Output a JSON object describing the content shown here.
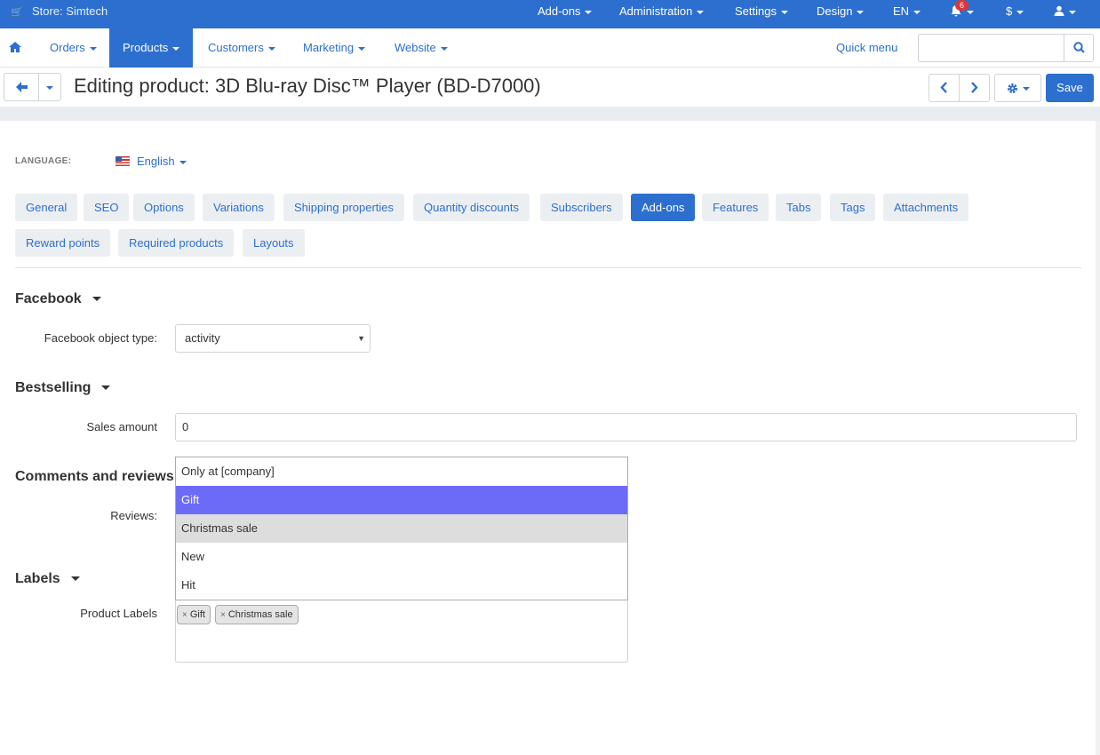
{
  "topbar": {
    "store_icon": "cart-icon",
    "store": "Store: Simtech",
    "menus": [
      "Add-ons",
      "Administration",
      "Settings",
      "Design",
      "EN"
    ],
    "notifications_count": "6",
    "currency": "$",
    "bell_icon": "bell-icon",
    "user_icon": "user-icon"
  },
  "nav": {
    "home_icon": "home-icon",
    "items": [
      "Orders",
      "Products",
      "Customers",
      "Marketing",
      "Website"
    ],
    "quick_menu": "Quick menu",
    "search_icon": "search-icon"
  },
  "titlebar": {
    "title": "Editing product: 3D Blu-ray Disc™ Player (BD-D7000)",
    "save": "Save"
  },
  "language": {
    "label": "LANGUAGE:",
    "value": "English"
  },
  "tabs": [
    "General",
    "SEO",
    "Options",
    "Variations",
    "Shipping properties",
    "Quantity discounts",
    "Subscribers",
    "Add-ons",
    "Features",
    "Tabs",
    "Tags",
    "Attachments",
    "Reward points",
    "Required products",
    "Layouts"
  ],
  "active_tab": "Add-ons",
  "sections": {
    "facebook": {
      "title": "Facebook",
      "field_label": "Facebook object type:",
      "value": "activity"
    },
    "bestselling": {
      "title": "Bestselling",
      "field_label": "Sales amount",
      "value": "0"
    },
    "comments": {
      "title": "Comments and reviews",
      "field_label": "Reviews:"
    },
    "labels": {
      "title": "Labels",
      "field_label": "Product Labels"
    }
  },
  "dropdown_options": [
    "Only at [company]",
    "Gift",
    "Christmas sale",
    "New",
    "Hit"
  ],
  "selected_chips": [
    "Gift",
    "Christmas sale"
  ],
  "colors": {
    "primary": "#2c6fcf",
    "option_selected": "#6b6bf7",
    "option_hover": "#dddddd"
  }
}
